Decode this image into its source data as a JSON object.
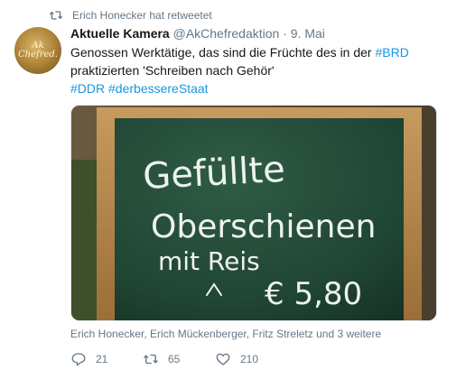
{
  "retweet_notice": {
    "text": "Erich Honecker hat retweetet"
  },
  "tweet": {
    "avatar_text": "Ak Chefred.",
    "name": "Aktuelle Kamera",
    "handle": "@AkChefredaktion",
    "separator": "·",
    "date": "9. Mai",
    "text_part1": "Genossen Werktätige, das sind die Früchte des in der ",
    "hashtag_brd": "#BRD",
    "text_part2": " praktizierten 'Schreiben nach Gehör'",
    "hashtag_ddr": "#DDR",
    "hashtag_staat": "#derbessereStaat",
    "image": {
      "line1": "Gefüllte",
      "line2": "Oberschienen",
      "line3": "mit Reis",
      "price": "€ 5,80"
    },
    "likers": "Erich Honecker, Erich Mückenberger, Fritz Streletz und 3 weitere",
    "counts": {
      "replies": "21",
      "retweets": "65",
      "likes": "210"
    }
  },
  "colors": {
    "accent": "#1b95e0",
    "muted": "#657786",
    "retweet_green": "#17bf63"
  },
  "icons": [
    "retweet-icon",
    "reply-icon",
    "like-icon"
  ]
}
